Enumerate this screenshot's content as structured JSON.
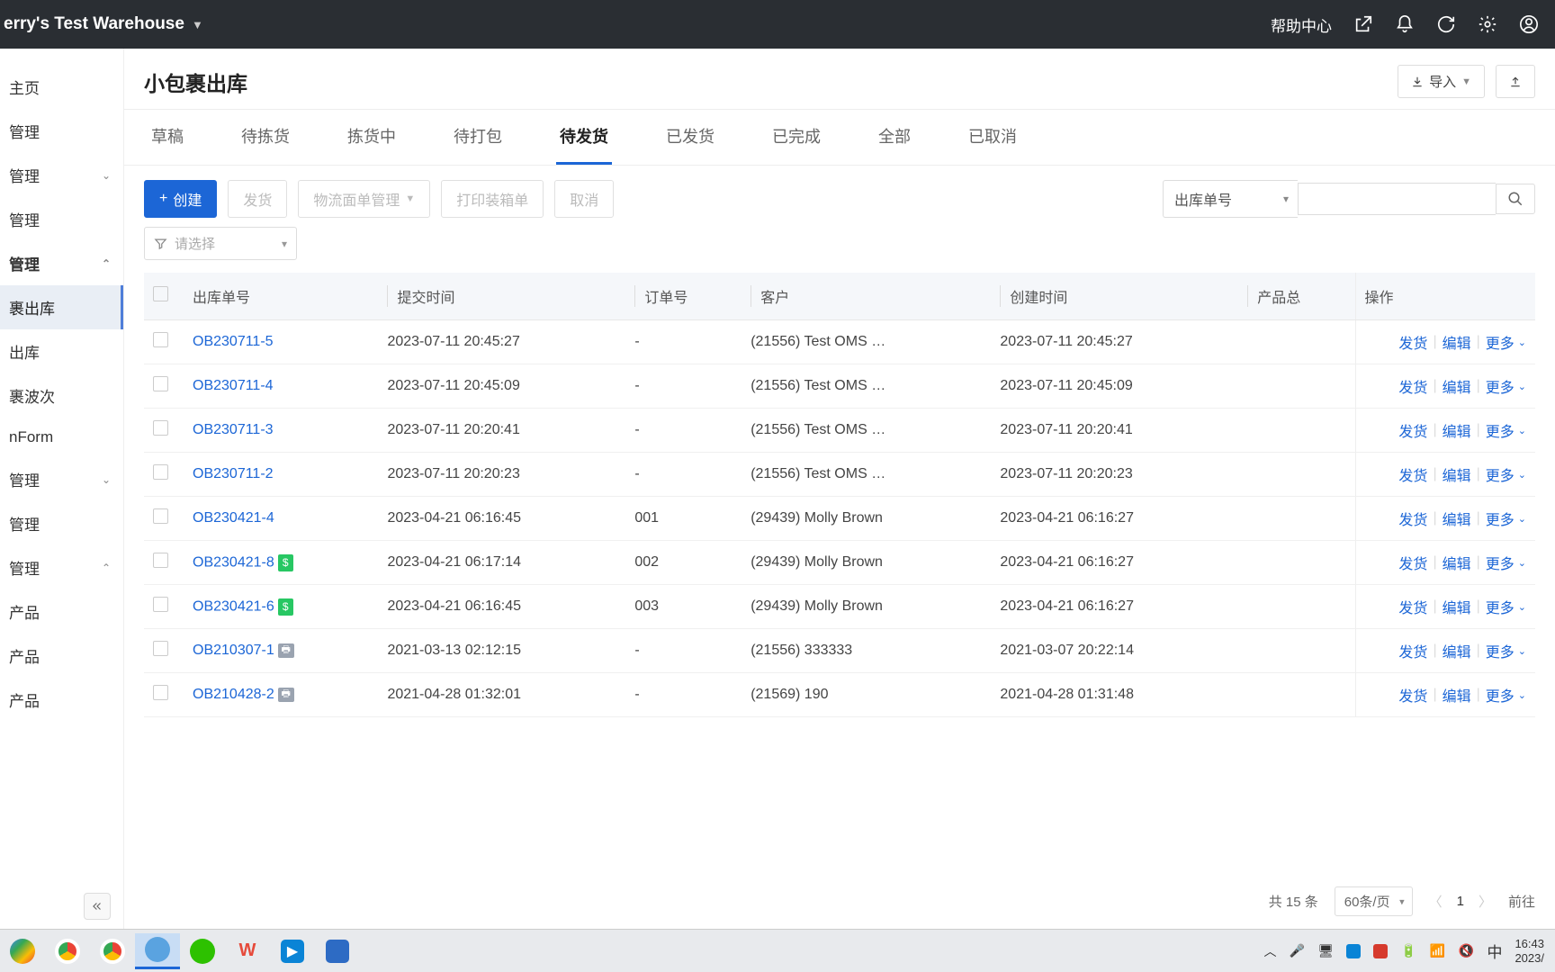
{
  "header": {
    "warehouse": "erry's Test Warehouse",
    "help": "帮助中心"
  },
  "sidebar": {
    "items": [
      {
        "label": "主页",
        "chev": "",
        "cls": ""
      },
      {
        "label": "管理",
        "chev": "",
        "cls": ""
      },
      {
        "label": "管理",
        "chev": "⌄",
        "cls": ""
      },
      {
        "label": "管理",
        "chev": "",
        "cls": ""
      },
      {
        "label": "管理",
        "chev": "⌃",
        "cls": "bold"
      },
      {
        "label": "裹出库",
        "chev": "",
        "cls": "active"
      },
      {
        "label": "出库",
        "chev": "",
        "cls": ""
      },
      {
        "label": "裹波次",
        "chev": "",
        "cls": ""
      },
      {
        "label": "nForm",
        "chev": "",
        "cls": ""
      },
      {
        "label": "管理",
        "chev": "⌄",
        "cls": ""
      },
      {
        "label": "管理",
        "chev": "",
        "cls": ""
      },
      {
        "label": "管理",
        "chev": "⌃",
        "cls": ""
      },
      {
        "label": "产品",
        "chev": "",
        "cls": ""
      },
      {
        "label": "产品",
        "chev": "",
        "cls": ""
      },
      {
        "label": "产品",
        "chev": "",
        "cls": ""
      }
    ]
  },
  "page": {
    "title": "小包裹出库",
    "import_btn": "导入",
    "create_btn": "创建",
    "ship_btn": "发货",
    "logistics_btn": "物流面单管理",
    "print_btn": "打印装箱单",
    "cancel_btn": "取消",
    "search_type": "出库单号",
    "filter_placeholder": "请选择"
  },
  "tabs": [
    "草稿",
    "待拣货",
    "拣货中",
    "待打包",
    "待发货",
    "已发货",
    "已完成",
    "全部",
    "已取消"
  ],
  "active_tab": 4,
  "columns": [
    "出库单号",
    "提交时间",
    "订单号",
    "客户",
    "创建时间",
    "产品总",
    "操作"
  ],
  "row_actions": {
    "ship": "发货",
    "edit": "编辑",
    "more": "更多"
  },
  "rows": [
    {
      "id": "OB230711-5",
      "submit": "2023-07-11 20:45:27",
      "order": "-",
      "customer": "(21556) Test OMS …",
      "created": "2023-07-11 20:45:27",
      "badge": ""
    },
    {
      "id": "OB230711-4",
      "submit": "2023-07-11 20:45:09",
      "order": "-",
      "customer": "(21556) Test OMS …",
      "created": "2023-07-11 20:45:09",
      "badge": ""
    },
    {
      "id": "OB230711-3",
      "submit": "2023-07-11 20:20:41",
      "order": "-",
      "customer": "(21556) Test OMS …",
      "created": "2023-07-11 20:20:41",
      "badge": ""
    },
    {
      "id": "OB230711-2",
      "submit": "2023-07-11 20:20:23",
      "order": "-",
      "customer": "(21556) Test OMS …",
      "created": "2023-07-11 20:20:23",
      "badge": ""
    },
    {
      "id": "OB230421-4",
      "submit": "2023-04-21 06:16:45",
      "order": "001",
      "customer": "(29439) Molly Brown",
      "created": "2023-04-21 06:16:27",
      "badge": ""
    },
    {
      "id": "OB230421-8",
      "submit": "2023-04-21 06:17:14",
      "order": "002",
      "customer": "(29439) Molly Brown",
      "created": "2023-04-21 06:16:27",
      "badge": "green"
    },
    {
      "id": "OB230421-6",
      "submit": "2023-04-21 06:16:45",
      "order": "003",
      "customer": "(29439) Molly Brown",
      "created": "2023-04-21 06:16:27",
      "badge": "green"
    },
    {
      "id": "OB210307-1",
      "submit": "2021-03-13 02:12:15",
      "order": "-",
      "customer": "(21556) 333333",
      "created": "2021-03-07 20:22:14",
      "badge": "gray"
    },
    {
      "id": "OB210428-2",
      "submit": "2021-04-28 01:32:01",
      "order": "-",
      "customer": "(21569) 190",
      "created": "2021-04-28 01:31:48",
      "badge": "gray"
    }
  ],
  "pagination": {
    "total_text": "共 15 条",
    "page_size": "60条/页",
    "current": "1",
    "goto": "前往"
  },
  "taskbar": {
    "ime": "中",
    "time": "16:43",
    "date": "2023/"
  }
}
